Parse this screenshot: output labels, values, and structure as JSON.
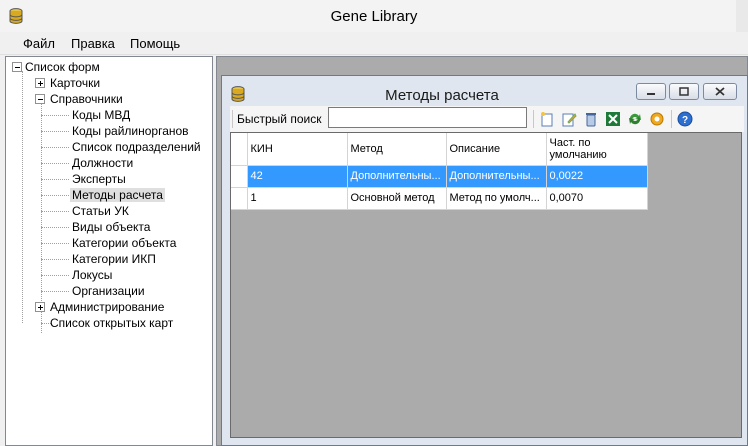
{
  "window": {
    "title": "Gene Library"
  },
  "menu": {
    "items": [
      "Файл",
      "Правка",
      "Помощь"
    ]
  },
  "tree": {
    "root": "Список форм",
    "cards": "Карточки",
    "refs": "Справочники",
    "children": [
      "Коды МВД",
      "Коды райлинорганов",
      "Список подразделений",
      "Должности",
      "Эксперты",
      "Методы расчета",
      "Статьи УК",
      "Виды объекта",
      "Категории объекта",
      "Категории ИКП",
      "Локусы",
      "Организации"
    ],
    "admin": "Администрирование",
    "open_cards": "Список открытых карт"
  },
  "child": {
    "title": "Методы расчета",
    "search_label": "Быстрый поиск",
    "search_value": ""
  },
  "grid": {
    "columns": [
      "КИН",
      "Метод",
      "Описание",
      "Част. по умолчанию"
    ],
    "rows": [
      [
        "42",
        "Дополнительны...",
        "Дополнительны...",
        "0,0022"
      ],
      [
        "1",
        "Основной метод",
        "Метод по умолч...",
        "0,0070"
      ]
    ]
  }
}
